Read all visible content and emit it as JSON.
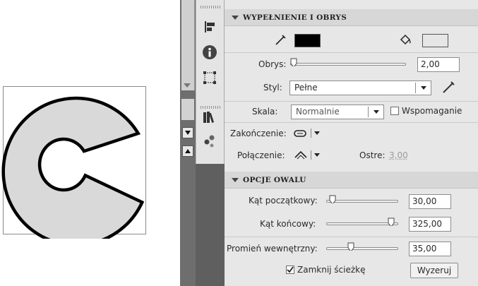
{
  "panel": {
    "fill_stroke": {
      "title": "WYPEŁNIENIE I OBRYS",
      "stroke_color": "#000000",
      "fill_color": "#e6e6e6",
      "stroke_icon": "pencil-icon",
      "fill_icon": "paint-bucket-icon",
      "stroke_width_label": "Obrys:",
      "stroke_width_value": "2,00",
      "style_label": "Styl:",
      "style_value": "Pełne",
      "scale_label": "Skala:",
      "scale_value": "Normalnie",
      "hinting_label": "Wspomaganie",
      "cap_label": "Zakończenie:",
      "join_label": "Połączenie:",
      "miter_label": "Ostre:",
      "miter_value": "3,00"
    },
    "oval": {
      "title": "OPCJE OWALU",
      "start_angle_label": "Kąt początkowy:",
      "start_angle_value": "30,00",
      "end_angle_label": "Kąt końcowy:",
      "end_angle_value": "325,00",
      "inner_radius_label": "Promień wewnętrzny:",
      "inner_radius_value": "35,00",
      "close_path_label": "Zamknij ścieżkę",
      "reset_label": "Wyzeruj"
    }
  },
  "toolbar": {
    "icons": [
      "align-icon",
      "info-icon",
      "transform-icon",
      "library-icon",
      "swatches-icon"
    ]
  },
  "colors": {
    "panel_bg": "#e7e7e7",
    "section_bg": "#d7d7d7",
    "shape_fill": "#d9d9d9",
    "shape_stroke": "#000000"
  }
}
